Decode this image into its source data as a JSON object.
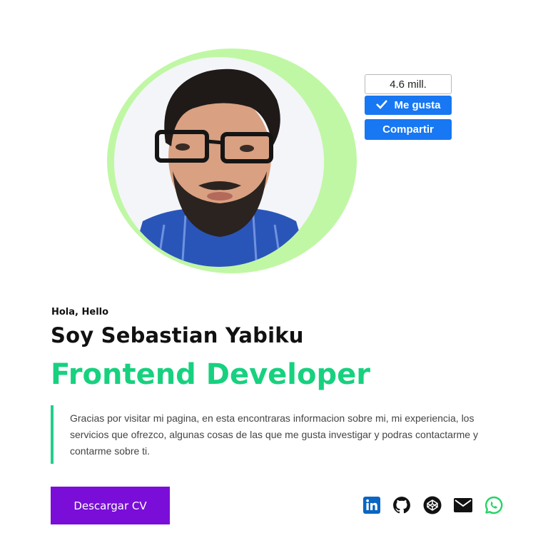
{
  "profile": {
    "photo_alt": "Sebastian Yabiku"
  },
  "facebook": {
    "count": "4.6 mill.",
    "like_label": "Me gusta",
    "share_label": "Compartir",
    "color": "#1877f2"
  },
  "hero": {
    "greeting": "Hola, Hello",
    "name": "Soy Sebastian Yabiku",
    "role": "Frontend Developer",
    "intro": "Gracias por visitar mi pagina, en esta encontraras informacion sobre mi, mi experiencia, los servicios que ofrezco, algunas cosas de las que me gusta investigar y podras contactarme y contarme sobre ti.",
    "accent": "#17d17f"
  },
  "actions": {
    "download_cv": "Descargar CV",
    "button_color": "#7a0ed8"
  },
  "social": [
    {
      "icon": "linkedin-icon",
      "color": "#0a66c2"
    },
    {
      "icon": "github-icon",
      "color": "#111111"
    },
    {
      "icon": "codepen-icon",
      "color": "#111111"
    },
    {
      "icon": "mail-icon",
      "color": "#111111"
    },
    {
      "icon": "whatsapp-icon",
      "color": "#25d366"
    }
  ]
}
